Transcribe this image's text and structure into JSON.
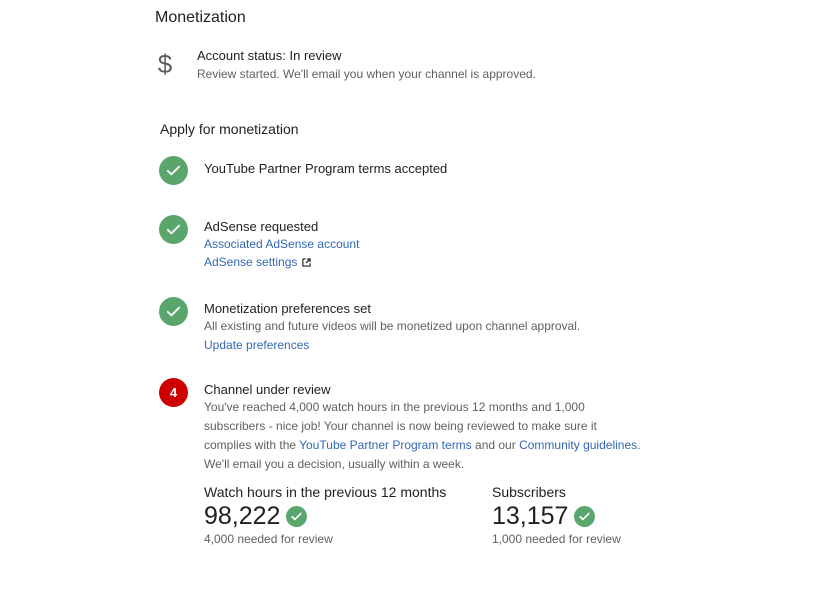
{
  "page": {
    "title": "Monetization"
  },
  "account_status": {
    "title": "Account status: In review",
    "description": "Review started. We'll email you when your channel is approved.",
    "icon": "dollar-icon"
  },
  "apply": {
    "section_title": "Apply for monetization",
    "steps": [
      {
        "status": "done",
        "title": "YouTube Partner Program terms accepted"
      },
      {
        "status": "done",
        "title": "AdSense requested",
        "links": [
          "Associated AdSense account",
          "AdSense settings"
        ]
      },
      {
        "status": "done",
        "title": "Monetization preferences set",
        "description": "All existing and future videos will be monetized upon channel approval.",
        "links": [
          "Update preferences"
        ]
      },
      {
        "status": "pending",
        "number": "4",
        "title": "Channel under review",
        "description_lines": [
          "You've reached 4,000 watch hours in the previous 12 months and 1,000",
          "subscribers - nice job! Your channel is now being reviewed to make sure it",
          "complies with the ",
          "YouTube Partner Program terms",
          " and our ",
          "Community guidelines",
          ".",
          "We'll email you a decision, usually within a week."
        ]
      }
    ]
  },
  "metrics": {
    "watch_hours": {
      "label": "Watch hours in the previous 12 months",
      "value": "98,222",
      "note": "4,000 needed for review"
    },
    "subscribers": {
      "label": "Subscribers",
      "value": "13,157",
      "note": "1,000 needed for review"
    }
  },
  "colors": {
    "success": "#5aa56b",
    "pending": "#cc0000",
    "link": "#3368b4"
  }
}
